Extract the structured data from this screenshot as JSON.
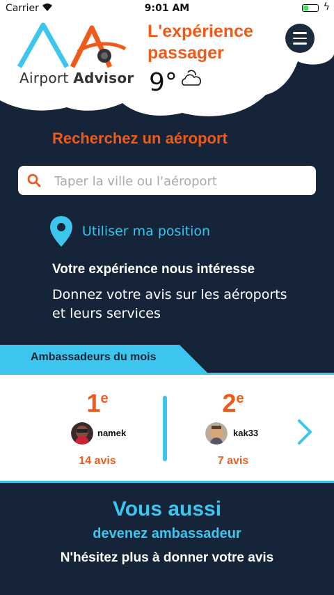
{
  "status_bar": {
    "carrier": "Carrier",
    "time": "9:01 AM"
  },
  "header": {
    "logo_word1": "Airport",
    "logo_word2": "Advisor",
    "tagline_line1": "L'expérience",
    "tagline_line2": "passager",
    "temperature": "9°",
    "weather_icon": "partly-cloudy-icon"
  },
  "search": {
    "title": "Recherchez un aéroport",
    "placeholder": "Taper la ville ou l'aéroport",
    "value": ""
  },
  "location": {
    "label": "Utiliser ma position"
  },
  "experience": {
    "title": "Votre expérience nous intéresse",
    "description": "Donnez votre avis sur les aéroports et leurs services"
  },
  "ambassadors": {
    "heading": "Ambassadeurs du mois",
    "items": [
      {
        "rank": "1",
        "suffix": "e",
        "username": "namek",
        "reviews": "14 avis"
      },
      {
        "rank": "2",
        "suffix": "e",
        "username": "kak33",
        "reviews": "7 avis"
      }
    ]
  },
  "cta": {
    "title": "Vous aussi",
    "subtitle": "devenez ambassadeur",
    "text": "N'hésitez plus à donner votre avis"
  },
  "colors": {
    "accent_orange": "#ef5a1b",
    "accent_cyan": "#3cc6ee",
    "background": "#16243a"
  }
}
